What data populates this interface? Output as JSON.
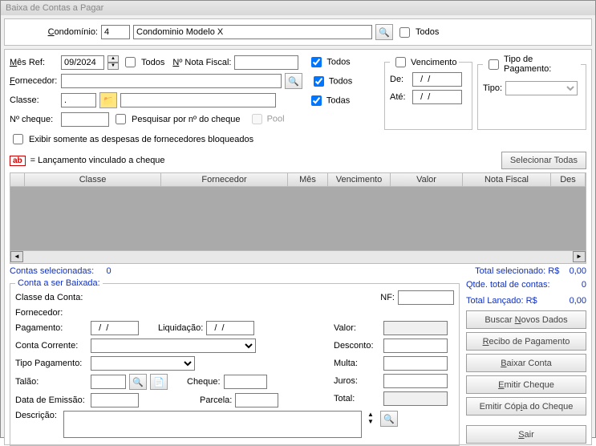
{
  "title": "Baixa de Contas a Pagar",
  "top": {
    "condoLabel": "Condomínio:",
    "condoCode": "4",
    "condoName": "Condominio Modelo X",
    "todos": "Todos"
  },
  "filters": {
    "mesRef": "Mês Ref:",
    "mesVal": "09/2024",
    "todos": "Todos",
    "nNota": "Nº Nota Fiscal:",
    "forn": "Fornecedor:",
    "classe": "Classe:",
    "classeDot": ".",
    "nCheque": "Nº cheque:",
    "pesq": "Pesquisar por nº do cheque",
    "pool": "Pool",
    "todas": "Todas",
    "exibir": "Exibir somente as despesas de fornecedores bloqueados",
    "venc": "Vencimento",
    "de": "De:",
    "ate": "Até:",
    "dateMask": "  /  /",
    "tipoPag": "Tipo de Pagamento:",
    "tipo": "Tipo:"
  },
  "legend": "= Lançamento vinculado a cheque",
  "selTodas": "Selecionar Todas",
  "cols": {
    "classe": "Classe",
    "forn": "Fornecedor",
    "mes": "Mês",
    "venc": "Vencimento",
    "valor": "Valor",
    "nota": "Nota Fiscal",
    "des": "Des"
  },
  "sum": {
    "contasSel": "Contas selecionadas:",
    "zero": "0",
    "totalSel": "Total selecionado: R$",
    "zval": "0,00"
  },
  "det": {
    "legend": "Conta a ser Baixada:",
    "classeConta": "Classe da Conta:",
    "forn": "Fornecedor:",
    "nf": "NF:",
    "pag": "Pagamento:",
    "liq": "Liquidação:",
    "conta": "Conta Corrente:",
    "tipoPag": "Tipo Pagamento:",
    "talao": "Talão:",
    "cheque": "Cheque:",
    "dataEm": "Data de Emissão:",
    "parcela": "Parcela:",
    "desc": "Descrição:",
    "valor": "Valor:",
    "desconto": "Desconto:",
    "multa": "Multa:",
    "juros": "Juros:",
    "total": "Total:",
    "dateMask": "  /  /"
  },
  "side": {
    "qtde": "Qtde. total de contas:",
    "q": "0",
    "totLanc": "Total Lançado: R$",
    "tlv": "0,00",
    "b1": "Buscar Novos Dados",
    "b2": "Recibo de Pagamento",
    "b3": "Baixar Conta",
    "b4": "Emitir Cheque",
    "b5": "Emitir Cópia do Cheque",
    "b6": "Sair"
  }
}
